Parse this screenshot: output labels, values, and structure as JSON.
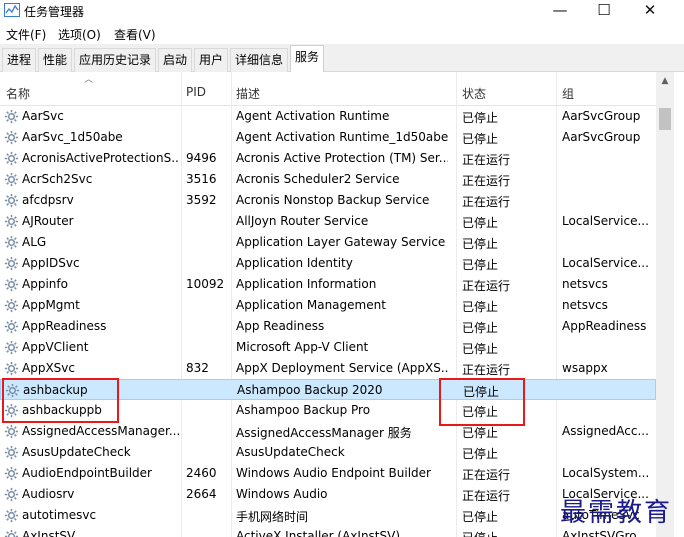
{
  "window": {
    "title": "任务管理器",
    "controls": {
      "minimize": "—",
      "maximize": "☐",
      "close": "✕"
    }
  },
  "menu": [
    {
      "label": "文件(F)"
    },
    {
      "label": "选项(O)"
    },
    {
      "label": "查看(V)"
    }
  ],
  "tabs": [
    {
      "label": "进程"
    },
    {
      "label": "性能"
    },
    {
      "label": "应用历史记录"
    },
    {
      "label": "启动"
    },
    {
      "label": "用户"
    },
    {
      "label": "详细信息"
    },
    {
      "label": "服务",
      "active": true
    }
  ],
  "columns": {
    "name": "名称",
    "pid": "PID",
    "description": "描述",
    "status": "状态",
    "group": "组"
  },
  "services": [
    {
      "name": "AarSvc",
      "pid": "",
      "description": "Agent Activation Runtime",
      "status": "已停止",
      "group": "AarSvcGroup"
    },
    {
      "name": "AarSvc_1d50abe",
      "pid": "",
      "description": "Agent Activation Runtime_1d50abe",
      "status": "已停止",
      "group": "AarSvcGroup"
    },
    {
      "name": "AcronisActiveProtectionS...",
      "pid": "9496",
      "description": "Acronis Active Protection (TM) Ser...",
      "status": "正在运行",
      "group": ""
    },
    {
      "name": "AcrSch2Svc",
      "pid": "3516",
      "description": "Acronis Scheduler2 Service",
      "status": "正在运行",
      "group": ""
    },
    {
      "name": "afcdpsrv",
      "pid": "3592",
      "description": "Acronis Nonstop Backup Service",
      "status": "正在运行",
      "group": ""
    },
    {
      "name": "AJRouter",
      "pid": "",
      "description": "AllJoyn Router Service",
      "status": "已停止",
      "group": "LocalService..."
    },
    {
      "name": "ALG",
      "pid": "",
      "description": "Application Layer Gateway Service",
      "status": "已停止",
      "group": ""
    },
    {
      "name": "AppIDSvc",
      "pid": "",
      "description": "Application Identity",
      "status": "已停止",
      "group": "LocalService..."
    },
    {
      "name": "Appinfo",
      "pid": "10092",
      "description": "Application Information",
      "status": "正在运行",
      "group": "netsvcs"
    },
    {
      "name": "AppMgmt",
      "pid": "",
      "description": "Application Management",
      "status": "已停止",
      "group": "netsvcs"
    },
    {
      "name": "AppReadiness",
      "pid": "",
      "description": "App Readiness",
      "status": "已停止",
      "group": "AppReadiness"
    },
    {
      "name": "AppVClient",
      "pid": "",
      "description": "Microsoft App-V Client",
      "status": "已停止",
      "group": ""
    },
    {
      "name": "AppXSvc",
      "pid": "832",
      "description": "AppX Deployment Service (AppXS...",
      "status": "正在运行",
      "group": "wsappx"
    },
    {
      "name": "ashbackup",
      "pid": "",
      "description": "Ashampoo Backup 2020",
      "status": "已停止",
      "group": "",
      "selected": true
    },
    {
      "name": "ashbackuppb",
      "pid": "",
      "description": "Ashampoo Backup Pro",
      "status": "已停止",
      "group": ""
    },
    {
      "name": "AssignedAccessManager...",
      "pid": "",
      "description": "AssignedAccessManager 服务",
      "status": "已停止",
      "group": "AssignedAcc..."
    },
    {
      "name": "AsusUpdateCheck",
      "pid": "",
      "description": "AsusUpdateCheck",
      "status": "已停止",
      "group": ""
    },
    {
      "name": "AudioEndpointBuilder",
      "pid": "2460",
      "description": "Windows Audio Endpoint Builder",
      "status": "正在运行",
      "group": "LocalSystem..."
    },
    {
      "name": "Audiosrv",
      "pid": "2664",
      "description": "Windows Audio",
      "status": "正在运行",
      "group": "LocalService..."
    },
    {
      "name": "autotimesvc",
      "pid": "",
      "description": "手机网络时间",
      "status": "已停止",
      "group": "autoTimeSvc"
    },
    {
      "name": "AxInstSV",
      "pid": "",
      "description": "ActiveX Installer (AxInstSV)",
      "status": "已停止",
      "group": "AxInstSVGro..."
    }
  ],
  "watermark": "最需教育",
  "colors": {
    "selection": "#cce8ff",
    "highlight_box": "#e8191a",
    "watermark": "#1a1a8c"
  }
}
